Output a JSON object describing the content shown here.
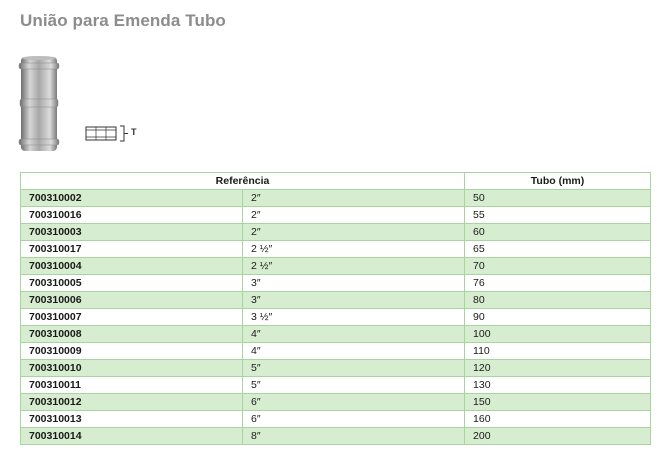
{
  "page": {
    "title": "União para Emenda Tubo"
  },
  "diagram": {
    "label": "T"
  },
  "table": {
    "headers": {
      "reference": "Referência",
      "tube": "Tubo (mm)"
    },
    "rows": [
      {
        "code": "700310002",
        "size": "2″",
        "tube": "50"
      },
      {
        "code": "700310016",
        "size": "2″",
        "tube": "55"
      },
      {
        "code": "700310003",
        "size": "2″",
        "tube": "60"
      },
      {
        "code": "700310017",
        "size": "2 ½″",
        "tube": "65"
      },
      {
        "code": "700310004",
        "size": "2 ½″",
        "tube": "70"
      },
      {
        "code": "700310005",
        "size": "3″",
        "tube": "76"
      },
      {
        "code": "700310006",
        "size": "3″",
        "tube": "80"
      },
      {
        "code": "700310007",
        "size": "3 ½″",
        "tube": "90"
      },
      {
        "code": "700310008",
        "size": "4″",
        "tube": "100"
      },
      {
        "code": "700310009",
        "size": "4″",
        "tube": "110"
      },
      {
        "code": "700310010",
        "size": "5″",
        "tube": "120"
      },
      {
        "code": "700310011",
        "size": "5″",
        "tube": "130"
      },
      {
        "code": "700310012",
        "size": "6″",
        "tube": "150"
      },
      {
        "code": "700310013",
        "size": "6″",
        "tube": "160"
      },
      {
        "code": "700310014",
        "size": "8″",
        "tube": "200"
      }
    ]
  },
  "colors": {
    "title": "#8c8c8c",
    "row_shade": "#d7edd0",
    "border": "#a9d3a0"
  }
}
